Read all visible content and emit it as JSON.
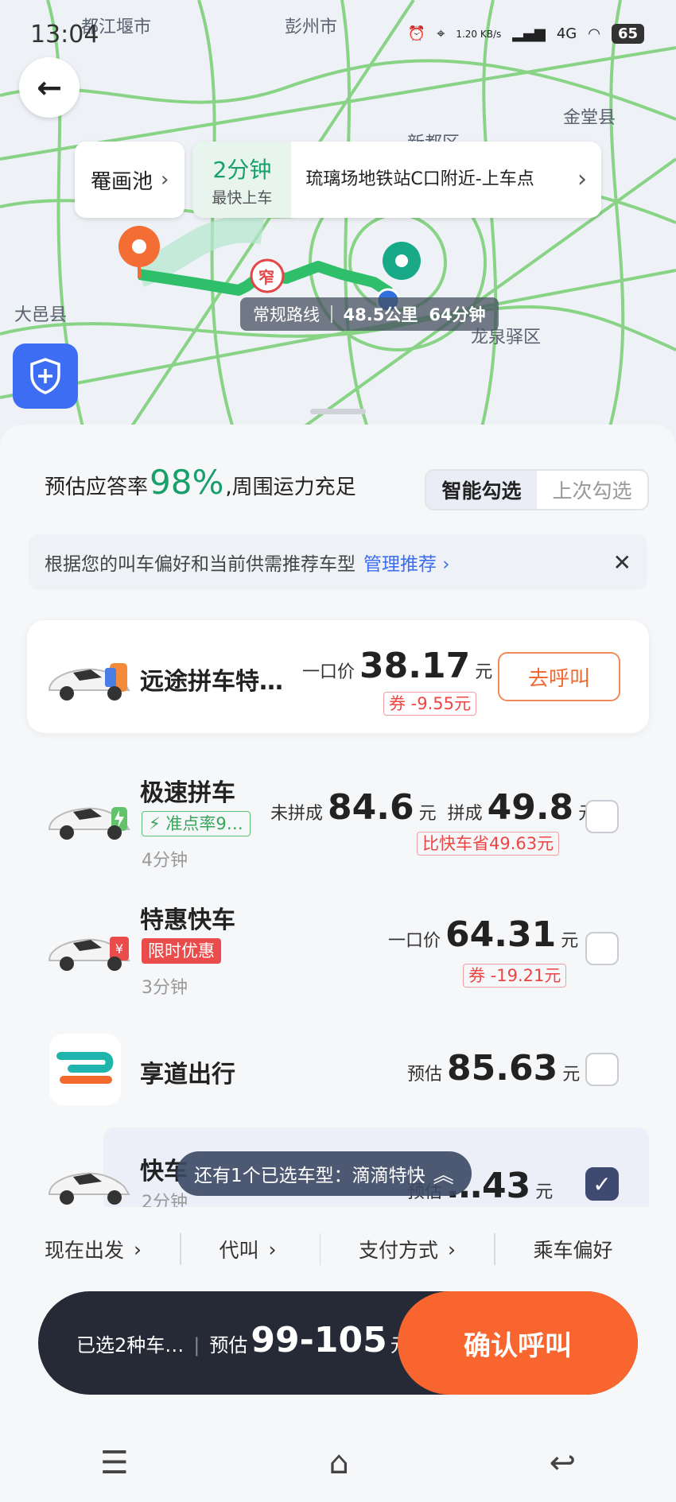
{
  "status_bar": {
    "time": "13:04",
    "net_speed": "1.20 KB/s",
    "signal": "4G",
    "battery": "65"
  },
  "map": {
    "place_labels": [
      "都江堰市",
      "彭州市",
      "金堂县",
      "新都区",
      "大邑县",
      "龙泉驿区"
    ],
    "pickup_from": "罨画池",
    "pickup_eta": "2分钟",
    "pickup_eta_caption": "最快上车",
    "pickup_address": "琉璃场地铁站C口附近-上车点",
    "narrow_marker": "窄",
    "route": {
      "label": "常规路线",
      "distance": "48.5公里",
      "duration": "64分钟"
    }
  },
  "header": {
    "rate_prefix": "预估应答率",
    "rate_value": "98%",
    "rate_suffix": ",周围运力充足"
  },
  "selection_tabs": [
    "智能勾选",
    "上次勾选"
  ],
  "notice": {
    "text": "根据您的叫车偏好和当前供需推荐车型",
    "link": "管理推荐 ›",
    "close": "✕"
  },
  "rides": [
    {
      "name": "远途拼车特…",
      "price_prefix": "一口价",
      "price": "38.17",
      "unit": "元",
      "coupon": "券 -9.55元",
      "action": "去呼叫"
    },
    {
      "name": "极速拼车",
      "tag": "准点率9…",
      "eta": "4分钟",
      "unmatched_label": "未拼成",
      "unmatched_price": "84.6",
      "matched_label": "拼成",
      "matched_price": "49.8",
      "unit": "元",
      "saving": "比快车省49.63元",
      "checked": false
    },
    {
      "name": "特惠快车",
      "tag": "限时优惠",
      "eta": "3分钟",
      "price_prefix": "一口价",
      "price": "64.31",
      "unit": "元",
      "coupon": "券 -19.21元",
      "checked": false
    },
    {
      "name": "享道出行",
      "price_prefix": "预估",
      "price": "85.63",
      "unit": "元",
      "checked": false
    },
    {
      "name": "快车",
      "eta": "2分钟",
      "price_prefix": "预估",
      "price": "…43",
      "unit": "元",
      "checked": true
    }
  ],
  "toast": {
    "text": "还有1个已选车型：滴滴特快"
  },
  "options": [
    "现在出发",
    "代叫",
    "支付方式",
    "乘车偏好"
  ],
  "bottom": {
    "selected": "已选2种车…",
    "estimate_prefix": "预估",
    "range": "99-105",
    "unit": "元",
    "confirm": "确认呼叫"
  },
  "colors": {
    "accent_green": "#18a06b",
    "confirm_orange": "#f9652e",
    "link_blue": "#3d6df2",
    "coupon_red": "#e44444"
  }
}
